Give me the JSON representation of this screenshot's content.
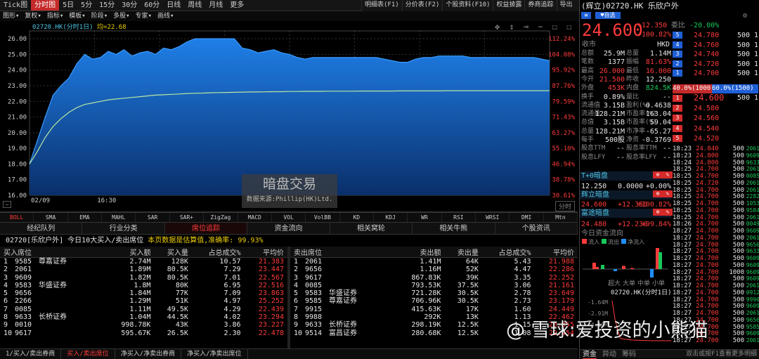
{
  "toolbar": {
    "tabs": [
      "Tick图",
      "分时图",
      "5日",
      "5分",
      "15分",
      "30分",
      "60分",
      "日线",
      "周线",
      "月线",
      "更多"
    ],
    "active": 1,
    "right": [
      "明细表(F1)",
      "分价表(F2)",
      "个股资料(F10)",
      "权益披露",
      "券商追踪",
      "导出"
    ],
    "row2": [
      "图形",
      "复权",
      "指标",
      "模板",
      "阶段",
      "多股",
      "专家",
      "画线"
    ]
  },
  "chart": {
    "label": "02720.HK(分时1日)",
    "avg_label": "均=22.68",
    "y_ticks": [
      "26.00",
      "25.00",
      "24.00",
      "23.00",
      "22.00",
      "21.00",
      "20.00",
      "19.00",
      "18.00",
      "17.00",
      "16.00"
    ],
    "pct_ticks": [
      "112.24%",
      "104.08%",
      "95.92%",
      "87.76%",
      "79.59%",
      "71.43%",
      "63.27%",
      "55.10%",
      "46.94%",
      "38.78%",
      "30.61%"
    ],
    "x_ticks": [
      "02/09",
      "16:30"
    ],
    "period_btn": "分时",
    "watermark": "暗盘交易",
    "source": "数据来源:Phillip(HK)Ltd.",
    "price_series": [
      18.0,
      19.5,
      21.0,
      22.4,
      23.0,
      23.5,
      24.4,
      25.0,
      24.7,
      24.8,
      25.2,
      25.0,
      25.3,
      24.9,
      25.1,
      25.2,
      25.0,
      25.4,
      25.3,
      25.5,
      25.8,
      26.0,
      26.0,
      26.0,
      26.0,
      26.0,
      26.0,
      25.4,
      25.3,
      25.1,
      25.2,
      25.3,
      25.1,
      25.0,
      24.8,
      24.7,
      24.8,
      24.8,
      24.8,
      24.8,
      24.8,
      24.8,
      24.8,
      24.8,
      24.8,
      24.7,
      24.6,
      24.5,
      24.5,
      24.7,
      24.8,
      24.8,
      24.9,
      24.9,
      24.9,
      24.9,
      24.8,
      24.8,
      24.8,
      24.8,
      24.8,
      24.8,
      24.8,
      24.8,
      24.8,
      24.7,
      24.6
    ],
    "avg_series": [
      18.0,
      18.8,
      19.7,
      20.4,
      20.9,
      21.3,
      21.6,
      21.8,
      21.9,
      22.0,
      22.1,
      22.15,
      22.2,
      22.25,
      22.3,
      22.35,
      22.4,
      22.42,
      22.45,
      22.47,
      22.5,
      22.52,
      22.53,
      22.55,
      22.56,
      22.57,
      22.58,
      22.59,
      22.6,
      22.6,
      22.61,
      22.62,
      22.62,
      22.63,
      22.63,
      22.64,
      22.64,
      22.64,
      22.65,
      22.65,
      22.65,
      22.65,
      22.66,
      22.66,
      22.66,
      22.66,
      22.66,
      22.67,
      22.67,
      22.67,
      22.67,
      22.67,
      22.67,
      22.68,
      22.68,
      22.68,
      22.68,
      22.68,
      22.68,
      22.68,
      22.68,
      22.68,
      22.68,
      22.68,
      22.68,
      22.68,
      22.68
    ],
    "ymin": 16,
    "ymax": 26.5
  },
  "indicators": [
    "BOLL",
    "SMA",
    "EMA",
    "MAHL",
    "SAR",
    "SAR+",
    "ZigZag",
    "MACD",
    "VOL",
    "VolBB",
    "KD",
    "KDJ",
    "WR",
    "RSI",
    "WRSI",
    "DMI",
    "Mtn"
  ],
  "subtabs": [
    "经纪队列",
    "行业分类",
    "席位追踪",
    "资金流向",
    "相关窝轮",
    "相关牛熊",
    "个股资讯"
  ],
  "info": {
    "prefix": "02720[乐欣户外] 今日10大买入/卖出席位",
    "mid": "本页数据是估算值,",
    "acc": "准确率:",
    "acc_val": "99.93%"
  },
  "buy_headers": [
    "买入席位",
    "买入额",
    "买入量",
    "占总成交%",
    "平均价"
  ],
  "buy": [
    [
      "1",
      "9585",
      "尊嘉证券",
      "2.74M",
      "128K",
      "10.57",
      "21.383"
    ],
    [
      "2",
      "2061",
      "",
      "1.89M",
      "80.5K",
      "7.29",
      "23.447"
    ],
    [
      "3",
      "9609",
      "",
      "1.82M",
      "80.5K",
      "7.01",
      "22.567"
    ],
    [
      "4",
      "9583",
      "华盛证券",
      "1.8M",
      "80K",
      "6.95",
      "22.516"
    ],
    [
      "5",
      "9656",
      "",
      "1.84M",
      "77K",
      "7.09",
      "23.863"
    ],
    [
      "6",
      "2266",
      "",
      "1.29M",
      "51K",
      "4.97",
      "25.252"
    ],
    [
      "7",
      "0085",
      "",
      "1.11M",
      "49.5K",
      "4.29",
      "22.439"
    ],
    [
      "8",
      "9633",
      "长桥证券",
      "1.04M",
      "44.5K",
      "4.02",
      "23.294"
    ],
    [
      "9",
      "0010",
      "",
      "998.78K",
      "43K",
      "3.86",
      "23.227"
    ],
    [
      "10",
      "9617",
      "",
      "595.67K",
      "26.5K",
      "2.30",
      "22.478"
    ]
  ],
  "sell_headers": [
    "卖出席位",
    "卖出额",
    "卖出量",
    "占总成交%",
    "平均价"
  ],
  "sell": [
    [
      "1",
      "2061",
      "",
      "1.41M",
      "64K",
      "5.43",
      "21.988"
    ],
    [
      "2",
      "9656",
      "",
      "1.16M",
      "52K",
      "4.47",
      "22.286"
    ],
    [
      "3",
      "9617",
      "",
      "867.83K",
      "39K",
      "3.35",
      "22.252"
    ],
    [
      "4",
      "0085",
      "",
      "793.53K",
      "37.5K",
      "3.06",
      "21.161"
    ],
    [
      "5",
      "9583",
      "华盛证券",
      "721.28K",
      "30.5K",
      "2.78",
      "23.649"
    ],
    [
      "6",
      "9585",
      "尊嘉证券",
      "706.96K",
      "30.5K",
      "2.73",
      "23.179"
    ],
    [
      "7",
      "9915",
      "",
      "415.63K",
      "17K",
      "1.60",
      "24.449"
    ],
    [
      "8",
      "9988",
      "",
      "292K",
      "13K",
      "1.13",
      "22.462"
    ],
    [
      "9",
      "9633",
      "长桥证券",
      "298.19K",
      "12.5K",
      "1.15",
      "23.855"
    ],
    [
      "10",
      "9514",
      "富昌证券",
      "280.68K",
      "12.5K",
      "1.08",
      "22.454"
    ]
  ],
  "bottomtabs": [
    "1/买入/卖出券商",
    "买入/卖出席位",
    "净买入/净卖出券商",
    "净买入/净卖出席位"
  ],
  "quote": {
    "title": "(辉立)02720.HK 乐欣户外",
    "self_btn": "自选",
    "price": "24.600",
    "chg": "+12.350",
    "chg_pct": "+100.82%",
    "weibi_label": "委比",
    "weibi": "-20.00%",
    "currency_label": "收市",
    "currency": "HKD",
    "stats": [
      [
        "总额",
        "25.9M",
        "总量",
        "1.14M"
      ],
      [
        "笔数",
        "1377",
        "振幅",
        "81.63%"
      ],
      [
        "最高",
        "26.000",
        "最低",
        "16.000"
      ],
      [
        "今开",
        "21.500",
        "昨收",
        "12.250"
      ],
      [
        "外盘",
        "453K",
        "内盘",
        "824.5K"
      ],
      [
        "换手",
        "0.89%",
        "量比",
        "--"
      ],
      [
        "流通值",
        "3.15B",
        "盈利(%)",
        "0.4638"
      ],
      [
        "流通量",
        "128.21M",
        "市盈率(%)",
        "163.04"
      ],
      [
        "总值",
        "3.15B",
        "市盈率(%)",
        "59.04"
      ],
      [
        "总量",
        "128.21M",
        "市净率",
        "-65.27"
      ],
      [
        "每手",
        "500股",
        "净资",
        "-0.3769"
      ],
      [
        "股息TTM",
        "--",
        "股息率TTM",
        "--"
      ],
      [
        "股息LFY",
        "--",
        "股息率LFY",
        "--"
      ]
    ],
    "asks": [
      [
        "5",
        "24.780",
        "500",
        "1"
      ],
      [
        "4",
        "24.760",
        "500",
        "1"
      ],
      [
        "3",
        "24.740",
        "500",
        "1"
      ],
      [
        "2",
        "24.720",
        "500",
        "1"
      ],
      [
        "1",
        "24.700",
        "500",
        "1"
      ]
    ],
    "bids": [
      [
        "1",
        "24.600",
        "500",
        "1"
      ],
      [
        "2",
        "24.580",
        "",
        ""
      ],
      [
        "3",
        "24.560",
        "",
        ""
      ],
      [
        "4",
        "24.540",
        "",
        ""
      ],
      [
        "5",
        "24.520",
        "",
        ""
      ]
    ],
    "ratio_buy": "40.0%(1000)",
    "ratio_sell": "60.0%(1500)",
    "ticks": [
      [
        "18:23",
        "24.840",
        "500",
        "2061"
      ],
      [
        "18:23",
        "24.800",
        "500",
        "9609"
      ],
      [
        "18:24",
        "24.800",
        "500",
        "9633"
      ],
      [
        "18:25",
        "24.700",
        "500",
        "2061"
      ],
      [
        "18:25",
        "24.700",
        "500",
        "0085"
      ],
      [
        "18:25",
        "24.720",
        "500",
        "2061"
      ],
      [
        "18:25",
        "24.700",
        "500",
        "2061"
      ],
      [
        "18:25",
        "24.700",
        "500",
        "2282"
      ],
      [
        "18:25",
        "24.700",
        "500",
        "1053"
      ],
      [
        "18:25",
        "24.700",
        "500",
        "9584"
      ],
      [
        "18:25",
        "24.700",
        "500",
        "2061"
      ],
      [
        "18:26",
        "24.700",
        "500",
        "0049"
      ],
      [
        "18:27",
        "24.700",
        "500",
        "9609"
      ],
      [
        "18:27",
        "24.700",
        "500",
        "2061"
      ],
      [
        "18:27",
        "24.700",
        "500",
        "9656"
      ],
      [
        "18:27",
        "24.700",
        "500",
        "9633"
      ],
      [
        "18:27",
        "24.700",
        "500",
        "9609"
      ],
      [
        "18:27",
        "24.700",
        "500",
        "9609"
      ],
      [
        "18:27",
        "24.700",
        "1000",
        "9609"
      ],
      [
        "18:27",
        "24.700",
        "500",
        "9609"
      ],
      [
        "18:27",
        "24.700",
        "500",
        "2061"
      ],
      [
        "18:27",
        "24.700",
        "500",
        "0912"
      ],
      [
        "18:27",
        "24.700",
        "500",
        "9990"
      ],
      [
        "18:27",
        "24.700",
        "500",
        "9609"
      ],
      [
        "18:27",
        "24.700",
        "500",
        "2061"
      ],
      [
        "18:27",
        "24.700",
        "500",
        "9656"
      ],
      [
        "18:27",
        "24.700",
        "500",
        "9585"
      ],
      [
        "18:27",
        "24.700",
        "500",
        "9609"
      ],
      [
        "18:27",
        "24.700",
        "500",
        "2061"
      ]
    ],
    "dark": [
      [
        "T+0暗盘",
        "",
        "",
        ""
      ],
      [
        "12.250",
        "0.0000",
        "+0.00%"
      ],
      [
        "辉立暗盘",
        "",
        "",
        ""
      ],
      [
        "24.600",
        "+12.350",
        "+100.82%"
      ],
      [
        "富途暗盘",
        "",
        "",
        ""
      ],
      [
        "24.480",
        "+12.230",
        "+99.84%"
      ]
    ],
    "flow_title": "今日资金流向",
    "flow_legend": [
      "流入",
      "流出",
      "净流入"
    ],
    "flow_cats": [
      "超大",
      "大单",
      "中单",
      "小单"
    ],
    "minute_label": "02720.HK(分时1日)",
    "minute_ticks": [
      "-1.64M",
      "-2.91M",
      "-4.19M"
    ],
    "bottom_tabs": [
      "资金",
      "异动",
      "筹码"
    ],
    "hint": "双击或按F1查看更多明细"
  },
  "watermark_brand": "@ 雪球:爱投资的小熊猫"
}
